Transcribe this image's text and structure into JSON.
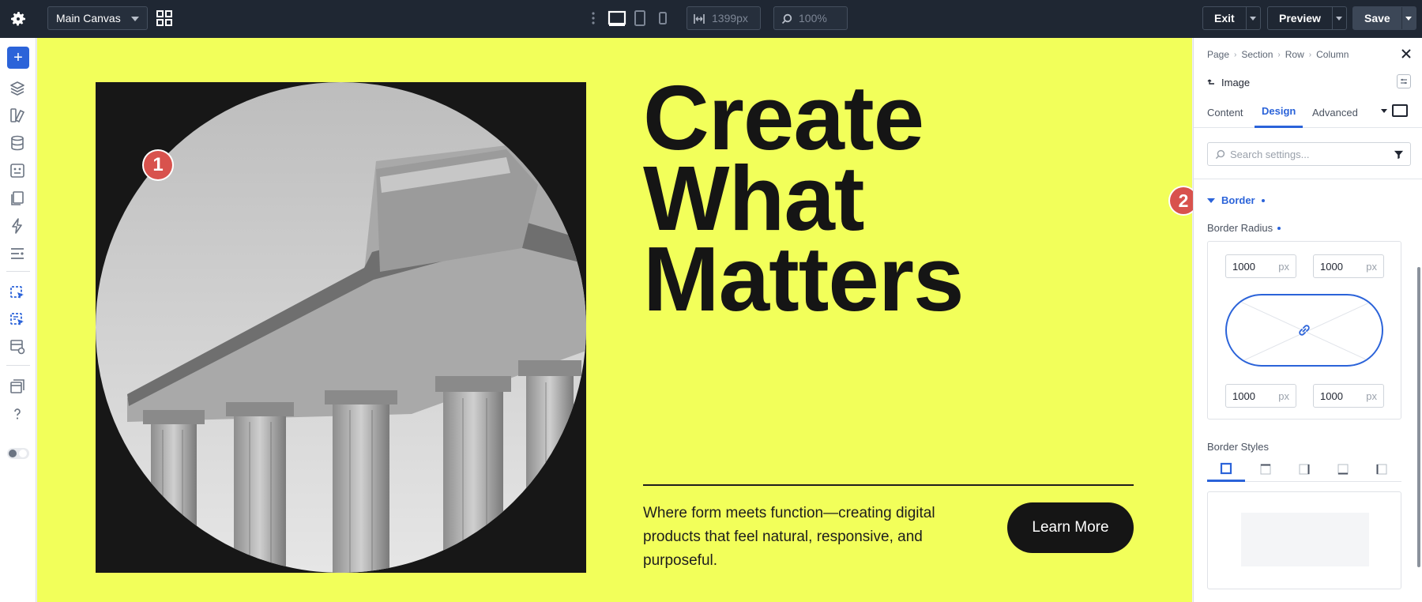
{
  "topbar": {
    "canvas_name": "Main Canvas",
    "width_value": "1399px",
    "zoom_value": "100%",
    "exit_label": "Exit",
    "preview_label": "Preview",
    "save_label": "Save"
  },
  "canvas": {
    "heading_line1": "Create",
    "heading_line2": "What",
    "heading_line3": "Matters",
    "paragraph": "Where form meets function—creating digital products that feel natural, responsive, and purposeful.",
    "button_label": "Learn More",
    "badge_1": "1",
    "badge_2": "2"
  },
  "panel": {
    "breadcrumb": [
      "Page",
      "Section",
      "Row",
      "Column"
    ],
    "module_title": "Image",
    "tabs": [
      "Content",
      "Design",
      "Advanced"
    ],
    "active_tab": "Design",
    "search_placeholder": "Search settings...",
    "section_title": "Border",
    "border_radius_label": "Border Radius",
    "radius_top_left": "1000",
    "radius_top_right": "1000",
    "radius_bottom_left": "1000",
    "radius_bottom_right": "1000",
    "radius_unit": "px",
    "border_styles_label": "Border Styles"
  },
  "colors": {
    "canvas_bg": "#f2ff5a",
    "accent": "#2b63d9",
    "topbar_bg": "#1f2733",
    "badge": "#d8524d"
  },
  "icons": {
    "settings": "gear-icon",
    "layout": "grid-icon",
    "devices": [
      "desktop-icon",
      "tablet-icon",
      "phone-icon"
    ],
    "close": "close-icon",
    "link": "link-icon",
    "filter": "filter-icon"
  }
}
